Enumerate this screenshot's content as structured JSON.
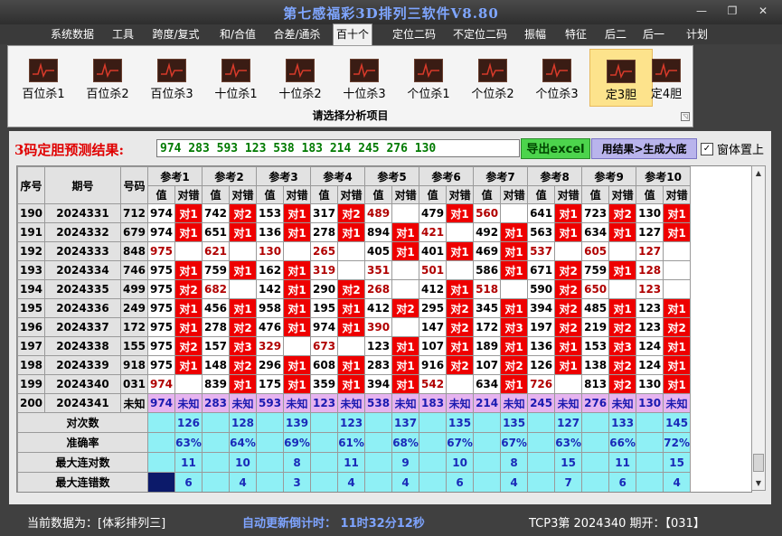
{
  "window": {
    "title": "第七感福彩3D排列三软件V8.80",
    "minimize": "—",
    "restore": "❐",
    "close": "✕"
  },
  "menu": [
    "系统数据",
    "工具",
    "跨度/复式",
    "和/合值",
    "合差/通杀",
    "百十个",
    "定位二码",
    "不定位二码",
    "振幅",
    "特征",
    "后二",
    "后一",
    "计划"
  ],
  "menu_active": 5,
  "ribbon": {
    "buttons": [
      "百位杀1",
      "百位杀2",
      "百位杀3",
      "十位杀1",
      "十位杀2",
      "十位杀3",
      "个位杀1",
      "个位杀2",
      "个位杀3",
      "定3胆",
      "定4胆"
    ],
    "active": 9,
    "caption": "请选择分析项目",
    "corner_glyph": "◹"
  },
  "result": {
    "label": "3码定胆预测结果:",
    "value": "974 283 593 123 538 183 214 245 276 130",
    "export_label": "导出excel",
    "generate_label": "用结果>生成大底",
    "ontop_label": "窗体置上",
    "ontop_checked": "✓"
  },
  "table": {
    "col_seq": "序号",
    "col_period": "期号",
    "col_number": "号码",
    "refs": [
      "参考1",
      "参考2",
      "参考3",
      "参考4",
      "参考5",
      "参考6",
      "参考7",
      "参考8",
      "参考9",
      "参考10"
    ],
    "sub_value": "值",
    "sub_mark": "对错",
    "rows": [
      {
        "seq": "190",
        "period": "2024331",
        "num": "712",
        "cells": [
          [
            "974",
            "对1"
          ],
          [
            "742",
            "对2"
          ],
          [
            "153",
            "对1"
          ],
          [
            "317",
            "对2"
          ],
          [
            "489",
            ""
          ],
          [
            "479",
            "对1"
          ],
          [
            "560",
            ""
          ],
          [
            "641",
            "对1"
          ],
          [
            "723",
            "对2"
          ],
          [
            "130",
            "对1"
          ]
        ]
      },
      {
        "seq": "191",
        "period": "2024332",
        "num": "679",
        "cells": [
          [
            "974",
            "对1"
          ],
          [
            "651",
            "对1"
          ],
          [
            "136",
            "对1"
          ],
          [
            "278",
            "对1"
          ],
          [
            "894",
            "对1"
          ],
          [
            "421",
            ""
          ],
          [
            "492",
            "对1"
          ],
          [
            "563",
            "对1"
          ],
          [
            "634",
            "对1"
          ],
          [
            "127",
            "对1"
          ]
        ]
      },
      {
        "seq": "192",
        "period": "2024333",
        "num": "848",
        "cells": [
          [
            "975",
            ""
          ],
          [
            "621",
            ""
          ],
          [
            "130",
            ""
          ],
          [
            "265",
            ""
          ],
          [
            "405",
            "对1"
          ],
          [
            "401",
            "对1"
          ],
          [
            "469",
            "对1"
          ],
          [
            "537",
            ""
          ],
          [
            "605",
            ""
          ],
          [
            "127",
            ""
          ]
        ]
      },
      {
        "seq": "193",
        "period": "2024334",
        "num": "746",
        "cells": [
          [
            "975",
            "对1"
          ],
          [
            "759",
            "对1"
          ],
          [
            "162",
            "对1"
          ],
          [
            "319",
            ""
          ],
          [
            "351",
            ""
          ],
          [
            "501",
            ""
          ],
          [
            "586",
            "对1"
          ],
          [
            "671",
            "对2"
          ],
          [
            "759",
            "对1"
          ],
          [
            "128",
            ""
          ]
        ]
      },
      {
        "seq": "194",
        "period": "2024335",
        "num": "499",
        "cells": [
          [
            "975",
            "对2"
          ],
          [
            "682",
            ""
          ],
          [
            "142",
            "对1"
          ],
          [
            "290",
            "对2"
          ],
          [
            "268",
            ""
          ],
          [
            "412",
            "对1"
          ],
          [
            "518",
            ""
          ],
          [
            "590",
            "对2"
          ],
          [
            "650",
            ""
          ],
          [
            "123",
            ""
          ]
        ]
      },
      {
        "seq": "195",
        "period": "2024336",
        "num": "249",
        "cells": [
          [
            "975",
            "对1"
          ],
          [
            "456",
            "对1"
          ],
          [
            "958",
            "对1"
          ],
          [
            "195",
            "对1"
          ],
          [
            "412",
            "对2"
          ],
          [
            "295",
            "对2"
          ],
          [
            "345",
            "对1"
          ],
          [
            "394",
            "对2"
          ],
          [
            "485",
            "对1"
          ],
          [
            "123",
            "对1"
          ]
        ]
      },
      {
        "seq": "196",
        "period": "2024337",
        "num": "172",
        "cells": [
          [
            "975",
            "对1"
          ],
          [
            "278",
            "对2"
          ],
          [
            "476",
            "对1"
          ],
          [
            "974",
            "对1"
          ],
          [
            "390",
            ""
          ],
          [
            "147",
            "对2"
          ],
          [
            "172",
            "对3"
          ],
          [
            "197",
            "对2"
          ],
          [
            "219",
            "对2"
          ],
          [
            "123",
            "对2"
          ]
        ]
      },
      {
        "seq": "197",
        "period": "2024338",
        "num": "155",
        "cells": [
          [
            "975",
            "对2"
          ],
          [
            "157",
            "对3"
          ],
          [
            "329",
            ""
          ],
          [
            "673",
            ""
          ],
          [
            "123",
            "对1"
          ],
          [
            "107",
            "对1"
          ],
          [
            "189",
            "对1"
          ],
          [
            "136",
            "对1"
          ],
          [
            "153",
            "对3"
          ],
          [
            "124",
            "对1"
          ]
        ]
      },
      {
        "seq": "198",
        "period": "2024339",
        "num": "918",
        "cells": [
          [
            "975",
            "对1"
          ],
          [
            "148",
            "对2"
          ],
          [
            "296",
            "对1"
          ],
          [
            "608",
            "对1"
          ],
          [
            "283",
            "对1"
          ],
          [
            "916",
            "对2"
          ],
          [
            "107",
            "对2"
          ],
          [
            "126",
            "对1"
          ],
          [
            "138",
            "对2"
          ],
          [
            "124",
            "对1"
          ]
        ]
      },
      {
        "seq": "199",
        "period": "2024340",
        "num": "031",
        "cells": [
          [
            "974",
            ""
          ],
          [
            "839",
            "对1"
          ],
          [
            "175",
            "对1"
          ],
          [
            "359",
            "对1"
          ],
          [
            "394",
            "对1"
          ],
          [
            "542",
            ""
          ],
          [
            "634",
            "对1"
          ],
          [
            "726",
            ""
          ],
          [
            "813",
            "对2"
          ],
          [
            "130",
            "对1"
          ]
        ]
      }
    ],
    "unknown_row": {
      "seq": "200",
      "period": "2024341",
      "num": "未知",
      "values": [
        "974",
        "283",
        "593",
        "123",
        "538",
        "183",
        "214",
        "245",
        "276",
        "130"
      ],
      "mark": "未知"
    },
    "stats": [
      {
        "label": "对次数",
        "values": [
          "126",
          "128",
          "139",
          "123",
          "137",
          "135",
          "135",
          "127",
          "133",
          "145"
        ]
      },
      {
        "label": "准确率",
        "values": [
          "63%",
          "64%",
          "69%",
          "61%",
          "68%",
          "67%",
          "67%",
          "63%",
          "66%",
          "72%"
        ]
      },
      {
        "label": "最大连对数",
        "values": [
          "11",
          "10",
          "8",
          "11",
          "9",
          "10",
          "8",
          "15",
          "11",
          "15"
        ]
      },
      {
        "label": "最大连错数",
        "values": [
          "6",
          "4",
          "3",
          "4",
          "4",
          "6",
          "4",
          "7",
          "6",
          "4"
        ]
      }
    ]
  },
  "scrollbar": {
    "up": "▲",
    "down": "▼"
  },
  "status": {
    "current": "当前数据为：[体彩排列三]",
    "countdown": "自动更新倒计时： 11时32分12秒",
    "issue": "TCP3第 2024340 期开：【031】"
  }
}
